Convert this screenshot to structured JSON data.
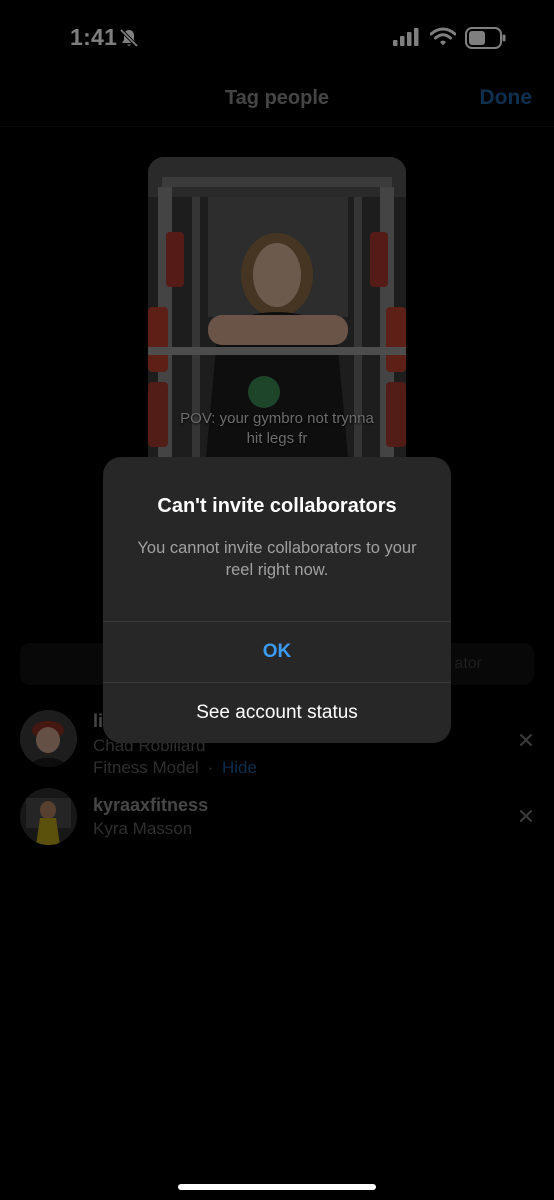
{
  "status_bar": {
    "time": "1:41"
  },
  "nav": {
    "title": "Tag people",
    "done_label": "Done"
  },
  "reel": {
    "caption_line1": "POV: your gymbro not trynna",
    "caption_line2": "hit legs fr"
  },
  "collab_bar": {
    "text_fragment": "ator"
  },
  "tags": [
    {
      "username_visible": "li",
      "full_name": "Chad Robillard",
      "category": "Fitness Model",
      "separator": "·",
      "hide_label": "Hide"
    },
    {
      "username": "kyraaxfitness",
      "full_name": "Kyra Masson"
    }
  ],
  "alert": {
    "title": "Can't invite collaborators",
    "message": "You cannot invite collaborators to your reel right now.",
    "ok_label": "OK",
    "status_label": "See account status"
  },
  "colors": {
    "accent_blue": "#3b9af5",
    "dim_blue": "#1f5f9e",
    "alert_bg": "#272727"
  }
}
